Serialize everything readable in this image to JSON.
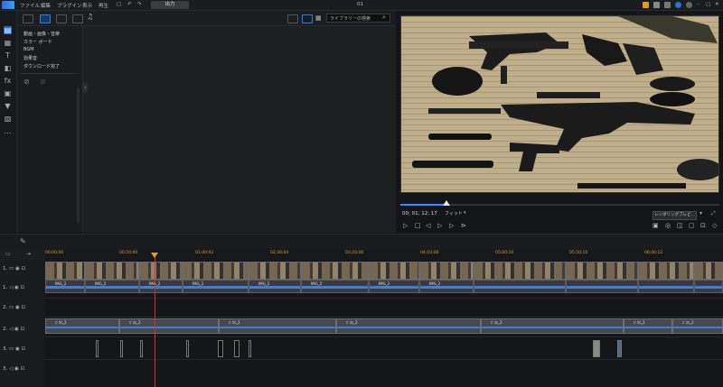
{
  "menu": {
    "items": [
      "ファイル",
      "編集",
      "プラグイン",
      "表示",
      "再生"
    ],
    "output_label": "出力",
    "project_title": "01"
  },
  "library": {
    "search_placeholder": "ライブラリーの検索",
    "categories": [
      "動画・画像・音楽",
      "カラー ボード",
      "BGM",
      "効果音",
      "ダウンロード完了"
    ]
  },
  "preview": {
    "timecode": "00; 01; 12; 17",
    "fit_label": "フィット",
    "render_label": "レンダリングプレビ..."
  },
  "timeline": {
    "ruler_ticks": [
      "00;00;00",
      "00;50;00",
      "01;40;02",
      "02;30;04",
      "03;20;06",
      "04;10;08",
      "05;00;10",
      "05;50;10",
      "06;40;12"
    ],
    "tracks": [
      "1.",
      "1.",
      "2.",
      "2.",
      "3.",
      "3."
    ],
    "clip_label": "IMG_2",
    "bgm_label": "ﾊﾞﾈﾙ_2"
  },
  "colors": {
    "accent": "#1f6fd0",
    "playhead": "#d03030",
    "ruler_text": "#c8a03a",
    "audio_wave": "#3f7fd6"
  }
}
